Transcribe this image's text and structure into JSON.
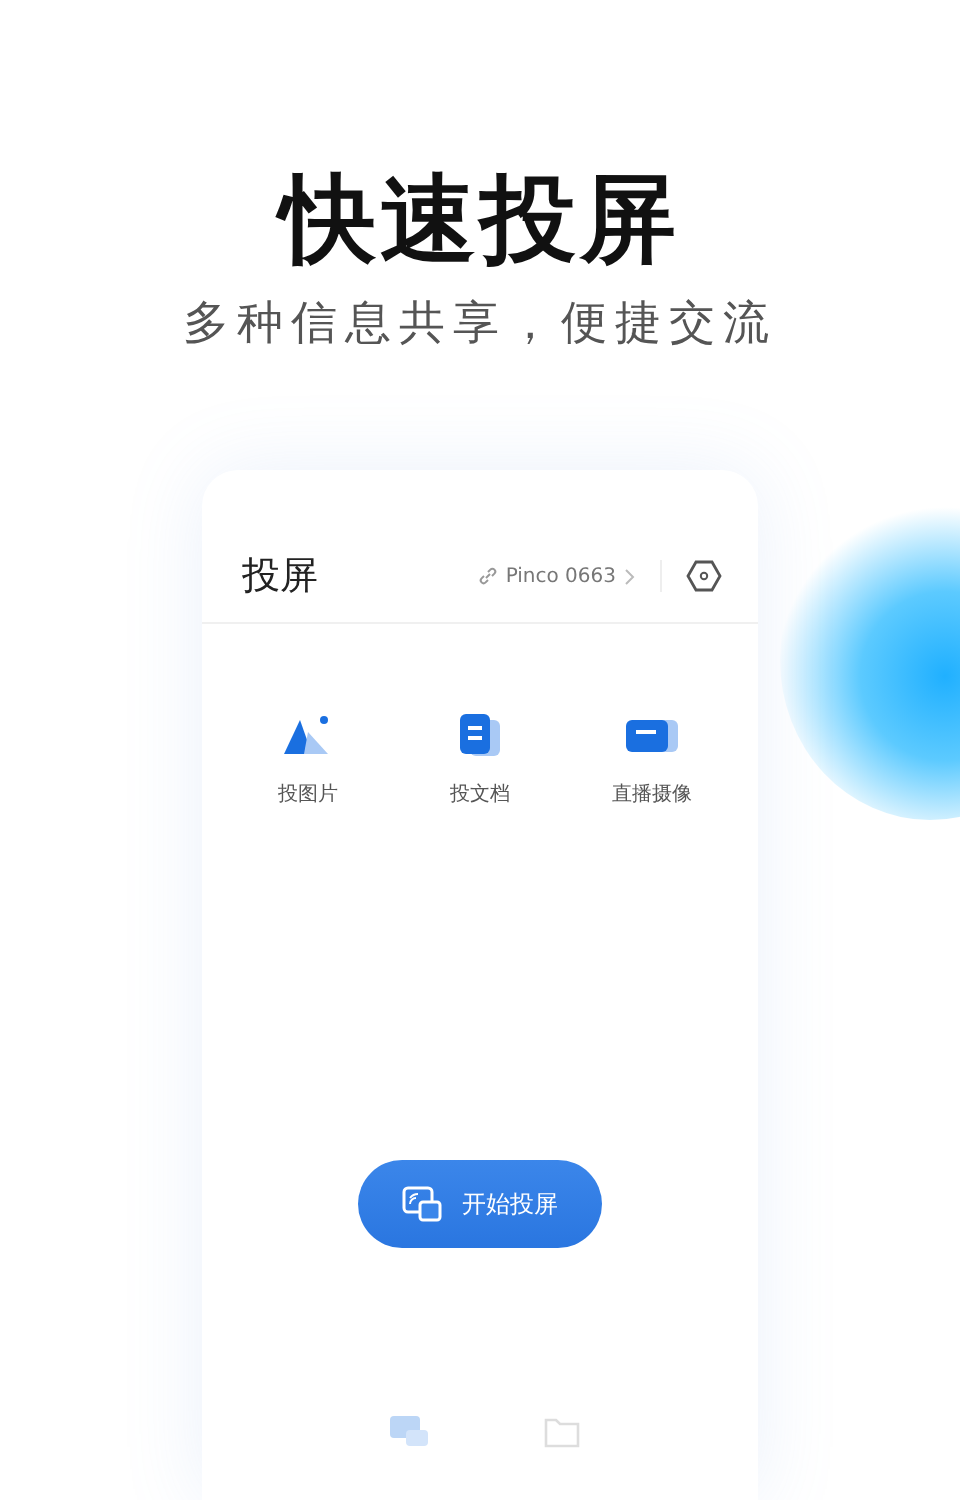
{
  "headline": "快速投屏",
  "subtitle": "多种信息共享，便捷交流",
  "app": {
    "title": "投屏",
    "device": "Pinco 0663",
    "actions": [
      {
        "kind": "image",
        "label": "投图片"
      },
      {
        "kind": "document",
        "label": "投文档"
      },
      {
        "kind": "camera",
        "label": "直播摄像"
      }
    ],
    "start_button": "开始投屏",
    "tabs": [
      {
        "kind": "cast",
        "selected": true
      },
      {
        "kind": "folder",
        "selected": false
      }
    ]
  }
}
